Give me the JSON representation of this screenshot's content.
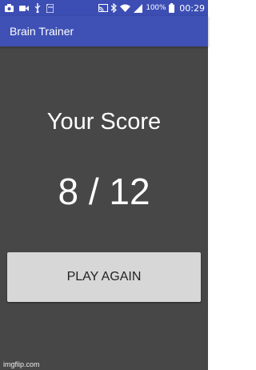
{
  "status_bar": {
    "battery_percent": "100%",
    "time": "00:29",
    "left_icons": [
      "camera-icon",
      "video-icon",
      "usb-icon",
      "sd-card-icon"
    ],
    "right_icons": [
      "cast-icon",
      "bluetooth-icon",
      "wifi-icon",
      "signal-icon",
      "battery-icon"
    ]
  },
  "app_bar": {
    "title": "Brain Trainer"
  },
  "main": {
    "score_title": "Your Score",
    "score_value": "8 / 12",
    "play_again_label": "PLAY AGAIN"
  },
  "watermark": "imgflip.com",
  "colors": {
    "app_bar": "#3f51b5",
    "status_bar": "#3c4eb4",
    "background": "#474747",
    "button": "#d7d7d7"
  }
}
